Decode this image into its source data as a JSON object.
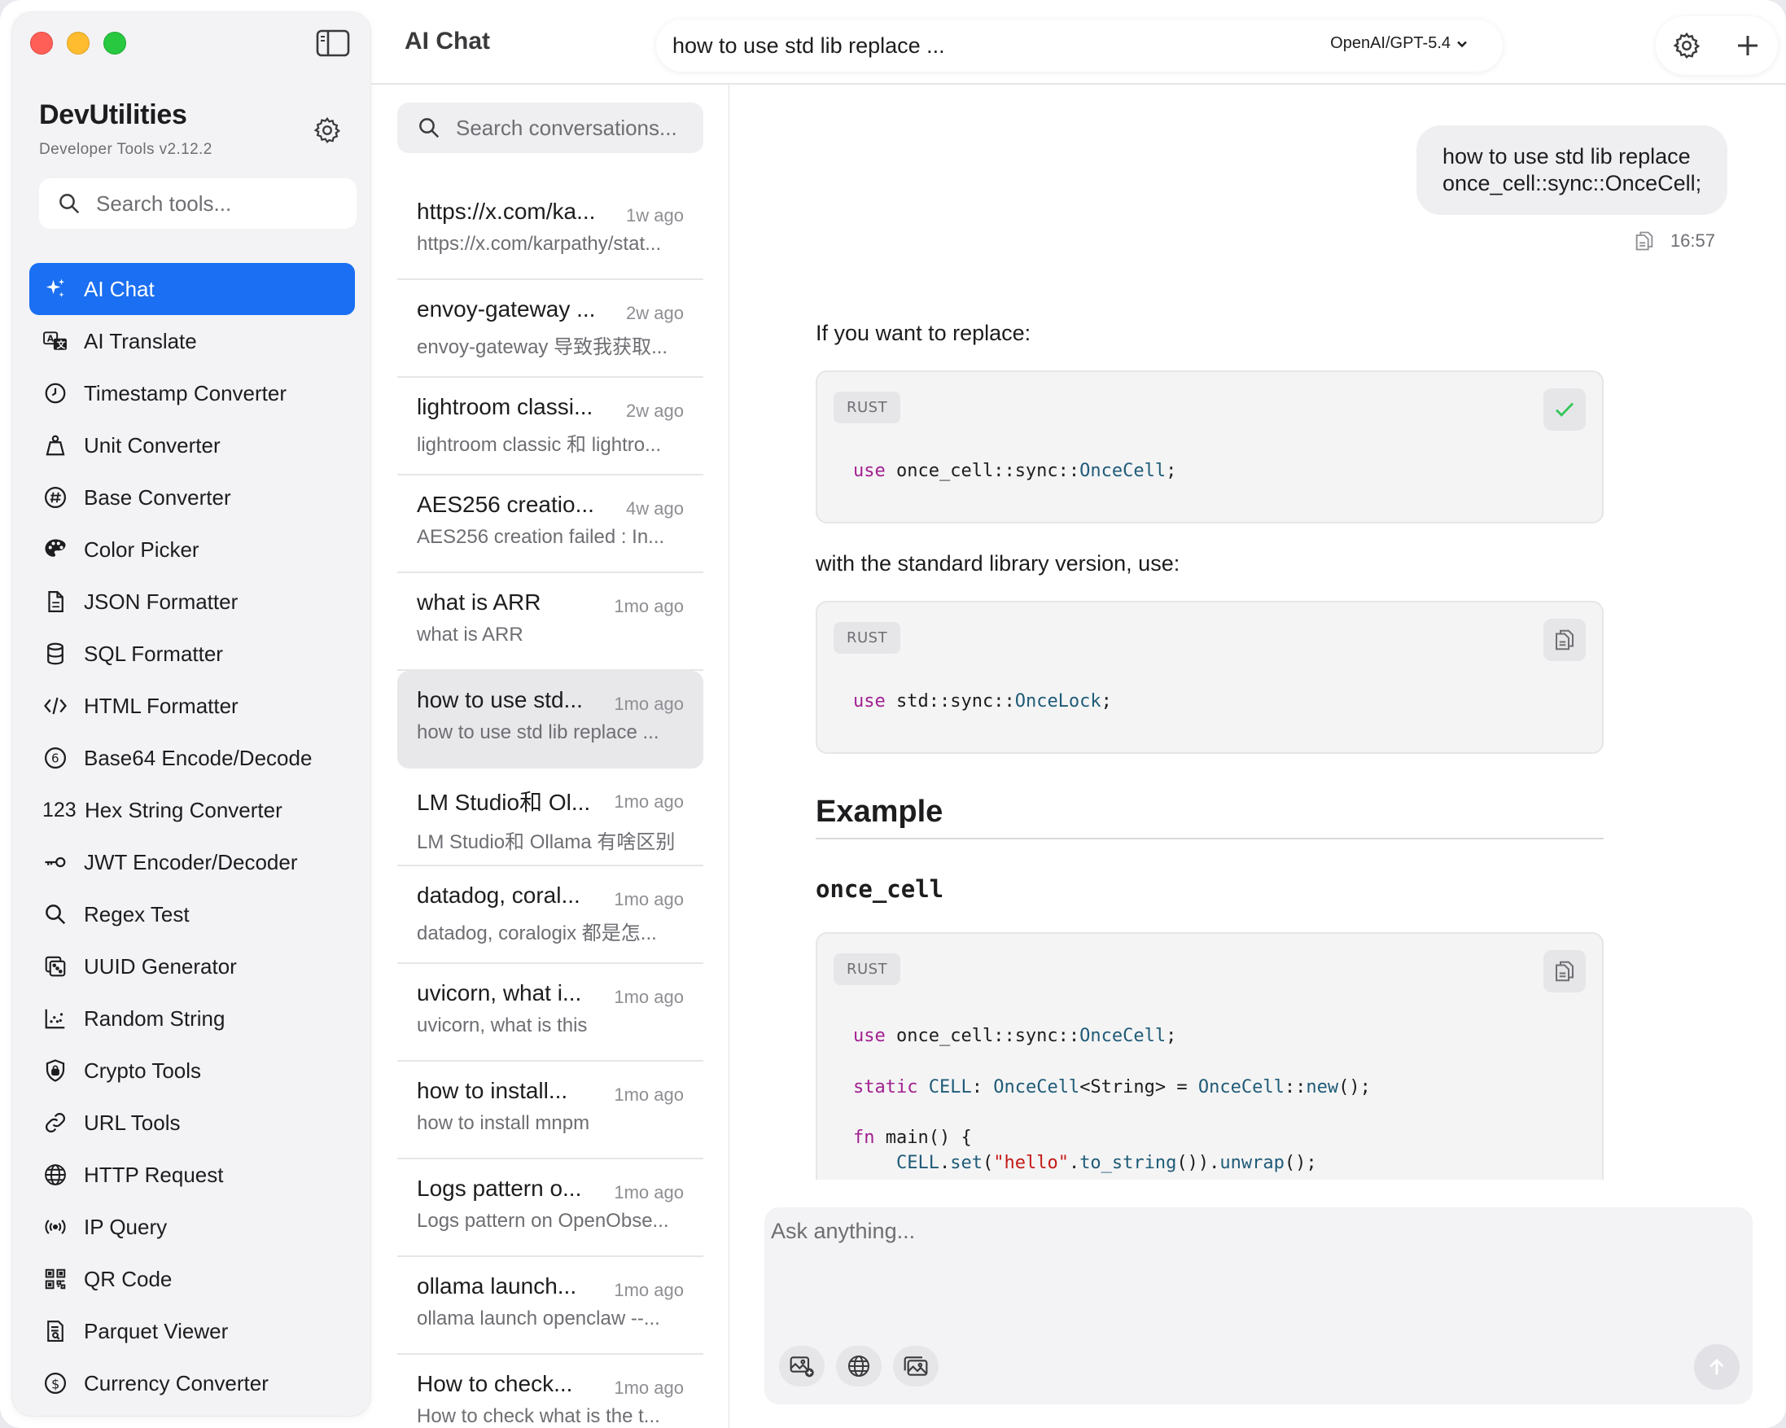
{
  "sidebar": {
    "app_title": "DevUtilities",
    "app_subtitle": "Developer Tools v2.12.2",
    "search_placeholder": "Search tools...",
    "accent_color": "#1a6ff2",
    "items": [
      {
        "label": "AI Chat",
        "icon": "sparkles-icon",
        "active": true
      },
      {
        "label": "AI Translate",
        "icon": "translate-icon"
      },
      {
        "label": "Timestamp Converter",
        "icon": "clock-icon"
      },
      {
        "label": "Unit Converter",
        "icon": "weight-icon"
      },
      {
        "label": "Base Converter",
        "icon": "hash-circle-icon"
      },
      {
        "label": "Color Picker",
        "icon": "palette-icon"
      },
      {
        "label": "JSON Formatter",
        "icon": "document-icon"
      },
      {
        "label": "SQL Formatter",
        "icon": "database-icon"
      },
      {
        "label": "HTML Formatter",
        "icon": "code-brackets-icon"
      },
      {
        "label": "Base64 Encode/Decode",
        "icon": "six-circle-icon"
      },
      {
        "label": "Hex String Converter",
        "icon": "numbers-icon",
        "icon_text": "123"
      },
      {
        "label": "JWT Encoder/Decoder",
        "icon": "key-icon"
      },
      {
        "label": "Regex Test",
        "icon": "magnifier-icon"
      },
      {
        "label": "UUID Generator",
        "icon": "dice-icon"
      },
      {
        "label": "Random String",
        "icon": "scatter-chart-icon"
      },
      {
        "label": "Crypto Tools",
        "icon": "lock-shield-icon"
      },
      {
        "label": "URL Tools",
        "icon": "link-icon"
      },
      {
        "label": "HTTP Request",
        "icon": "globe-icon"
      },
      {
        "label": "IP Query",
        "icon": "broadcast-icon"
      },
      {
        "label": "QR Code",
        "icon": "qr-code-icon"
      },
      {
        "label": "Parquet Viewer",
        "icon": "doc-search-icon"
      },
      {
        "label": "Currency Converter",
        "icon": "dollar-circle-icon"
      }
    ]
  },
  "conversations": {
    "header": "AI Chat",
    "search_placeholder": "Search conversations...",
    "items": [
      {
        "title": "https://x.com/ka...",
        "time": "1w ago",
        "preview": "https://x.com/karpathy/stat..."
      },
      {
        "title": "envoy-gateway ...",
        "time": "2w ago",
        "preview": "envoy-gateway 导致我获取..."
      },
      {
        "title": "lightroom classi...",
        "time": "2w ago",
        "preview": "lightroom classic 和 lightro..."
      },
      {
        "title": "AES256 creatio...",
        "time": "4w ago",
        "preview": "AES256 creation failed : In..."
      },
      {
        "title": "what is ARR",
        "time": "1mo ago",
        "preview": "what is ARR"
      },
      {
        "title": "how to use std...",
        "time": "1mo ago",
        "preview": "how to use std lib replace ...",
        "active": true
      },
      {
        "title": "LM Studio和 Ol...",
        "time": "1mo ago",
        "preview": "LM Studio和 Ollama 有啥区别"
      },
      {
        "title": "datadog, coral...",
        "time": "1mo ago",
        "preview": "datadog, coralogix 都是怎..."
      },
      {
        "title": "uvicorn, what i...",
        "time": "1mo ago",
        "preview": "uvicorn, what is this"
      },
      {
        "title": "how to install...",
        "time": "1mo ago",
        "preview": "how to install mnpm"
      },
      {
        "title": "Logs pattern o...",
        "time": "1mo ago",
        "preview": "Logs pattern on OpenObse..."
      },
      {
        "title": "ollama launch...",
        "time": "1mo ago",
        "preview": "ollama launch openclaw --..."
      },
      {
        "title": "How to check...",
        "time": "1mo ago",
        "preview": "How to check what is the t..."
      }
    ]
  },
  "topbar": {
    "topic": "how to use std lib replace ...",
    "model": "OpenAI/GPT-5.4"
  },
  "chat": {
    "user_message": "how to use std lib replace once_cell::sync::OnceCell;",
    "user_time": "16:57",
    "answer_intro": "If you want to replace:",
    "code_lang": "RUST",
    "code1_kw": "use",
    "code1_path": " once_cell::sync::",
    "code1_type": "OnceCell",
    "code1_end": ";",
    "answer_mid": "with the standard library version, use:",
    "code2_kw": "use",
    "code2_path": " std::sync::",
    "code2_type": "OnceLock",
    "code2_end": ";",
    "example_heading": "Example",
    "example_sub": "once_cell",
    "code3": {
      "l1_kw": "use",
      "l1_path": " once_cell::sync::",
      "l1_type": "OnceCell",
      "l1_end": ";",
      "l2_kw": "static",
      "l2_a": " CELL",
      "l2_b": ": ",
      "l2_t1": "OnceCell",
      "l2_c": "<String> = ",
      "l2_t2": "OnceCell",
      "l2_d": "::",
      "l2_fn": "new",
      "l2_e": "();",
      "l3_kw": "fn",
      "l3_a": " main() {",
      "l4_a": "CELL",
      "l4_b": ".",
      "l4_fn": "set",
      "l4_c": "(",
      "l4_str": "\"hello\"",
      "l4_d": ".",
      "l4_fn2": "to_string",
      "l4_e": "()).",
      "l4_fn3": "unwrap",
      "l4_f": "();"
    }
  },
  "composer": {
    "placeholder": "Ask anything..."
  }
}
